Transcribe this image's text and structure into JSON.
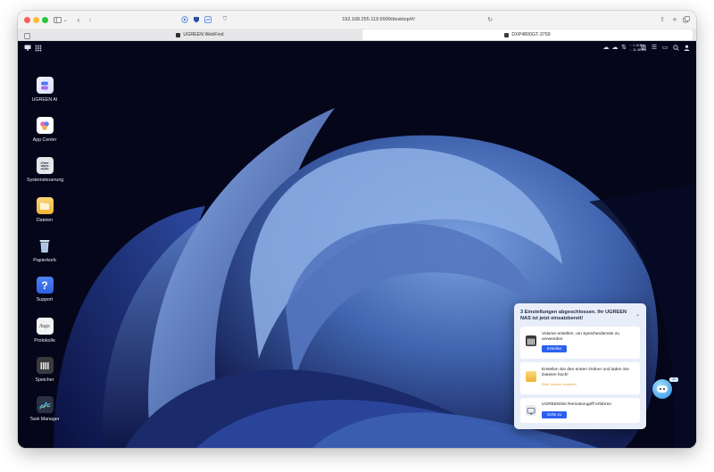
{
  "browser": {
    "url": "192.168.255.119:9999/desktop/#/",
    "tabs": [
      {
        "label": "UGREEN WebFind",
        "active": false
      },
      {
        "label": "DXP4800GT-3759",
        "active": true
      }
    ]
  },
  "topbar": {
    "net_up": "↑ 1.1KB/s",
    "net_down": "↓ 11.4KB/s"
  },
  "desktop_icons": [
    {
      "label": "UGREEN AI",
      "icon": "ugreen-ai-icon"
    },
    {
      "label": "App Center",
      "icon": "app-center-icon"
    },
    {
      "label": "Systemsteuerung",
      "icon": "control-panel-icon"
    },
    {
      "label": "Dateien",
      "icon": "folder-icon"
    },
    {
      "label": "Papierkorb",
      "icon": "trash-icon"
    },
    {
      "label": "Support",
      "icon": "support-icon"
    },
    {
      "label": "Protokolle",
      "icon": "logs-icon"
    },
    {
      "label": "Speicher",
      "icon": "storage-icon"
    },
    {
      "label": "Task Manager",
      "icon": "task-manager-icon"
    }
  ],
  "setup_panel": {
    "title": "3 Einstellungen abgeschlossen. Ihr UGREEN NAS ist jetzt einsatzbereit!",
    "cards": [
      {
        "text": "Volume erstellen, um Speicherdienste zu verwenden",
        "action": "Erstellen",
        "action_type": "button",
        "icon": "volume-icon"
      },
      {
        "text": "Erstellen Sie den ersten Ordner und laden Sie Dateien hoch!",
        "action": "Bitte Volume erstellen",
        "action_type": "link",
        "icon": "folder-icon"
      },
      {
        "text": "UGREENlink Remotezugriff erfahren",
        "action": "Gehe zu",
        "action_type": "button",
        "icon": "ugreenlink-icon"
      }
    ]
  },
  "assistant": {
    "badge": "AI"
  },
  "colors": {
    "accent": "#2b61f0",
    "desktop_bg": "#05061a",
    "warning_link": "#e8a23d"
  }
}
